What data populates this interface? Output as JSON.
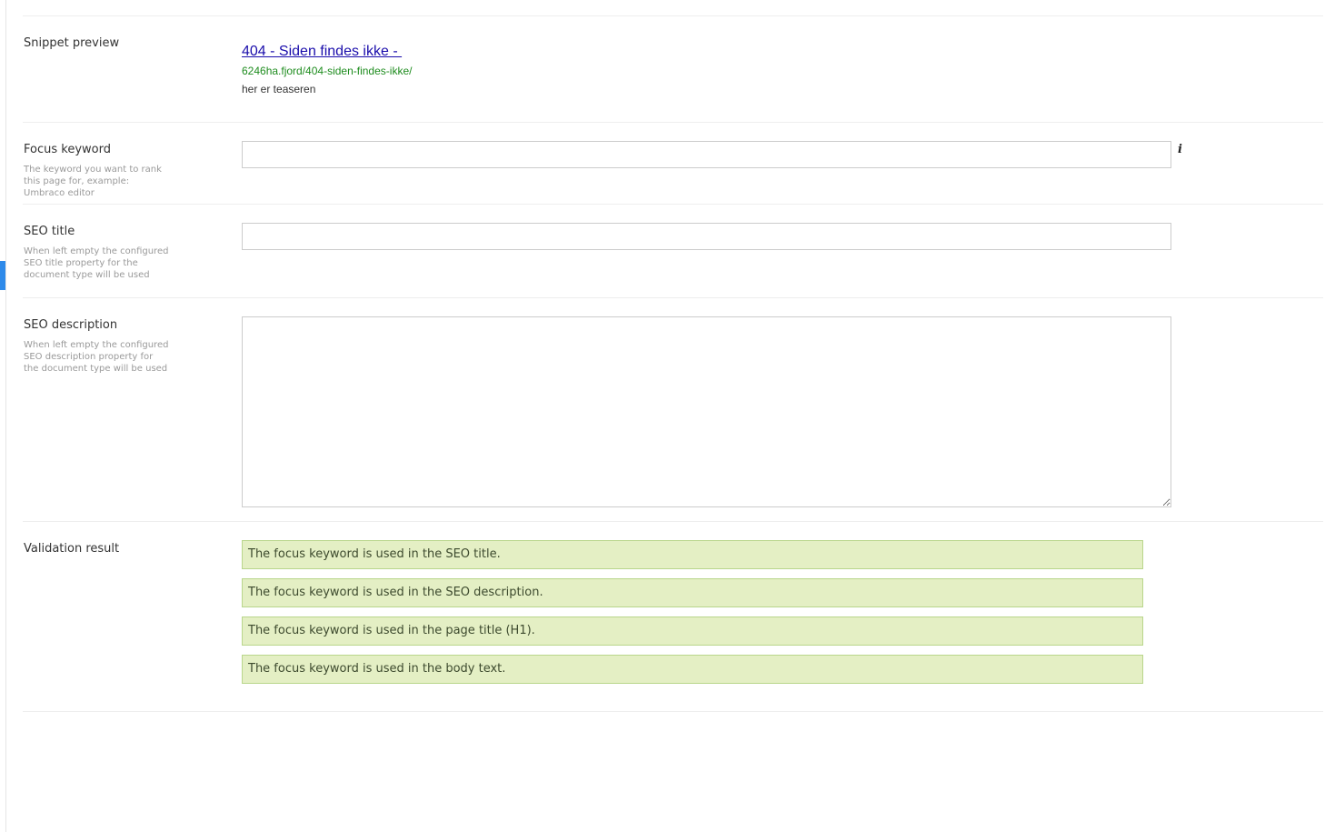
{
  "snippet_preview": {
    "label": "Snippet preview",
    "title": "404 - Siden findes ikke - ",
    "url": "6246ha.fjord/404-siden-findes-ikke/",
    "description": "her er teaseren"
  },
  "focus_keyword": {
    "label": "Focus keyword",
    "description": "The keyword you want to rank this page for, example: Umbraco editor",
    "value": "",
    "placeholder": "",
    "info_icon": "info-icon"
  },
  "seo_title": {
    "label": "SEO title",
    "description": "When left empty the configured SEO title property for the document type will be used",
    "value": "",
    "placeholder": ""
  },
  "seo_description": {
    "label": "SEO description",
    "description": "When left empty the configured SEO description property for the document type will be used",
    "value": "",
    "placeholder": ""
  },
  "validation": {
    "label": "Validation result",
    "results": [
      "The focus keyword is used in the SEO title.",
      "The focus keyword is used in the SEO description.",
      "The focus keyword is used in the page title (H1).",
      "The focus keyword is used in the body text."
    ]
  },
  "colors": {
    "link": "#1a0dab",
    "url": "#1e8c1e",
    "success_bg": "#e4efc4",
    "success_border": "#b9d68c",
    "active_marker": "#2e8aea"
  }
}
